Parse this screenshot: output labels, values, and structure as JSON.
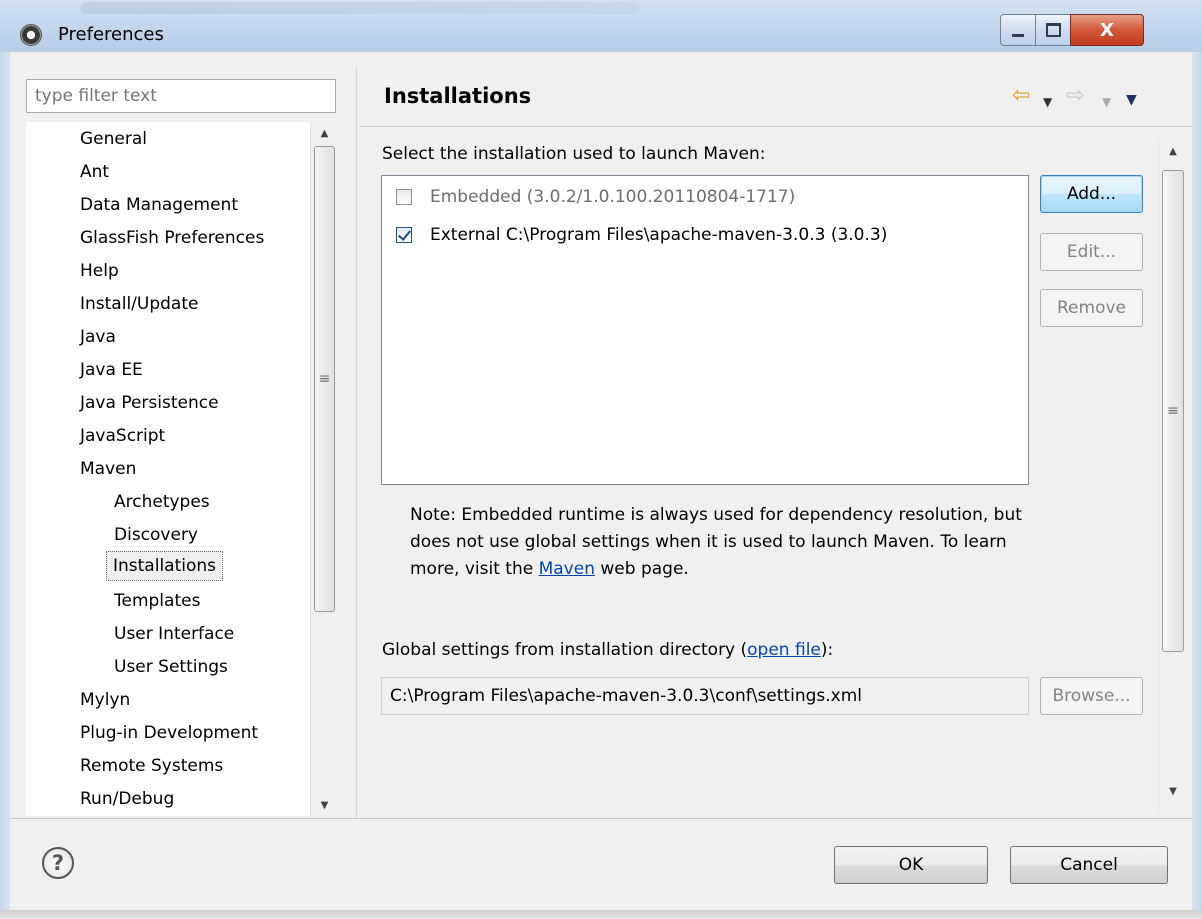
{
  "window": {
    "title": "Preferences",
    "close_glyph": "X"
  },
  "sidebar": {
    "filter_placeholder": "type filter text",
    "items": [
      {
        "label": "General",
        "level": 0
      },
      {
        "label": "Ant",
        "level": 0
      },
      {
        "label": "Data Management",
        "level": 0
      },
      {
        "label": "GlassFish Preferences",
        "level": 0
      },
      {
        "label": "Help",
        "level": 0
      },
      {
        "label": "Install/Update",
        "level": 0
      },
      {
        "label": "Java",
        "level": 0
      },
      {
        "label": "Java EE",
        "level": 0
      },
      {
        "label": "Java Persistence",
        "level": 0
      },
      {
        "label": "JavaScript",
        "level": 0
      },
      {
        "label": "Maven",
        "level": 0
      },
      {
        "label": "Archetypes",
        "level": 1
      },
      {
        "label": "Discovery",
        "level": 1
      },
      {
        "label": "Installations",
        "level": 1,
        "selected": true
      },
      {
        "label": "Templates",
        "level": 1
      },
      {
        "label": "User Interface",
        "level": 1
      },
      {
        "label": "User Settings",
        "level": 1
      },
      {
        "label": "Mylyn",
        "level": 0
      },
      {
        "label": "Plug-in Development",
        "level": 0
      },
      {
        "label": "Remote Systems",
        "level": 0
      },
      {
        "label": "Run/Debug",
        "level": 0
      }
    ]
  },
  "page": {
    "title": "Installations",
    "select_label": "Select the installation used to launch Maven:",
    "installations": [
      {
        "label": "Embedded (3.0.2/1.0.100.20110804-1717)",
        "checked": false,
        "enabled": false
      },
      {
        "label": "External C:\\Program Files\\apache-maven-3.0.3 (3.0.3)",
        "checked": true,
        "enabled": true
      }
    ],
    "buttons": {
      "add": "Add...",
      "edit": "Edit...",
      "remove": "Remove",
      "browse": "Browse..."
    },
    "note": {
      "before_link": "Note: Embedded runtime is always used for dependency resolution, but does not use global settings when it is used to launch Maven. To learn more, visit the ",
      "link": "Maven",
      "after_link": " web page."
    },
    "global_settings": {
      "label_before": "Global settings from installation directory (",
      "link": "open file",
      "label_after": "):",
      "path": "C:\\Program Files\\apache-maven-3.0.3\\conf\\settings.xml"
    }
  },
  "footer": {
    "ok": "OK",
    "cancel": "Cancel",
    "help_glyph": "?"
  },
  "icons": {
    "back": "back-arrow-icon",
    "forward": "forward-arrow-icon",
    "view_menu": "view-menu-icon",
    "help": "help-icon"
  },
  "colors": {
    "link": "#0645ad",
    "back_arrow": "#e2a11a",
    "close_button": "#d4583a"
  }
}
